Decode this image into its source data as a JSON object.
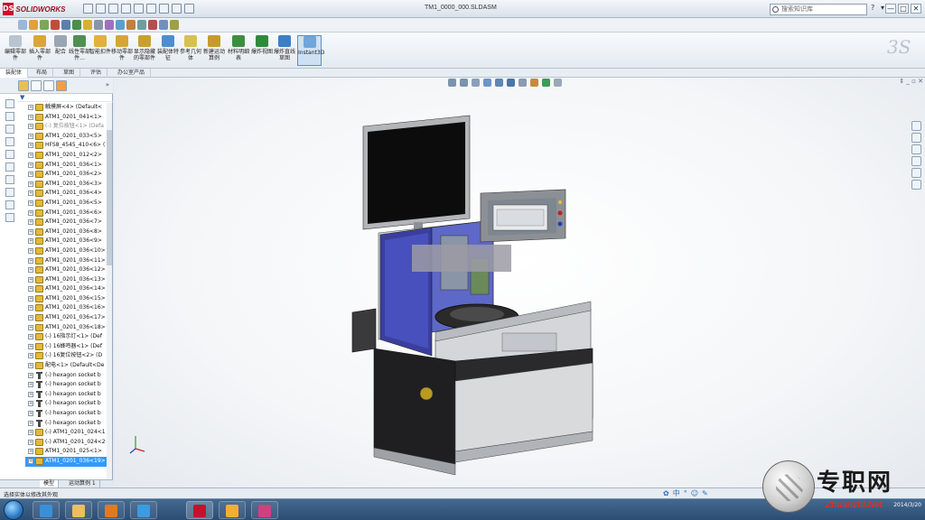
{
  "app": {
    "logo_text": "SOLIDWORKS",
    "document_title": "TM1_0000_000.SLDASM",
    "search_placeholder": "搜索知识库",
    "window_controls": [
      "—",
      "□",
      "✕"
    ]
  },
  "command_manager": {
    "buttons": [
      {
        "label": "编辑零部件",
        "icon": "edit-component-icon"
      },
      {
        "label": "插入零部件",
        "icon": "insert-component-icon"
      },
      {
        "label": "配合",
        "icon": "mate-icon"
      },
      {
        "label": "线性零部件...",
        "icon": "linear-pattern-icon"
      },
      {
        "label": "智能扣件",
        "icon": "smart-fastener-icon"
      },
      {
        "label": "移动零部件",
        "icon": "move-component-icon"
      },
      {
        "label": "显示隐藏的零部件",
        "icon": "show-hidden-icon"
      },
      {
        "label": "装配体特征",
        "icon": "assembly-feature-icon"
      },
      {
        "label": "参考几何体",
        "icon": "reference-geometry-icon"
      },
      {
        "label": "新建运动算例",
        "icon": "motion-study-icon"
      },
      {
        "label": "材料明细表",
        "icon": "bom-icon"
      },
      {
        "label": "爆炸视图",
        "icon": "exploded-view-icon"
      },
      {
        "label": "爆炸直线草图",
        "icon": "explode-line-icon"
      },
      {
        "label": "Instant3D",
        "icon": "instant3d-icon"
      }
    ]
  },
  "tabs": [
    "装配体",
    "布局",
    "草图",
    "评估",
    "办公室产品"
  ],
  "tree": {
    "items": [
      {
        "label": "触摸屏<4> (Default<",
        "type": "part",
        "grey": false,
        "selected": false
      },
      {
        "label": "ATM1_0201_041<1>",
        "type": "part",
        "grey": false,
        "selected": false
      },
      {
        "label": "(-) 复位按钮<1> (Defa",
        "type": "part",
        "grey": true,
        "selected": false
      },
      {
        "label": "ATM1_0201_033<5>",
        "type": "part",
        "grey": false,
        "selected": false
      },
      {
        "label": "HFS8_4545_410<6> (",
        "type": "part",
        "grey": false,
        "selected": false
      },
      {
        "label": "ATM1_0201_012<2>",
        "type": "part",
        "grey": false,
        "selected": false
      },
      {
        "label": "ATM1_0201_036<1>",
        "type": "part",
        "grey": false,
        "selected": false
      },
      {
        "label": "ATM1_0201_036<2>",
        "type": "part",
        "grey": false,
        "selected": false
      },
      {
        "label": "ATM1_0201_036<3>",
        "type": "part",
        "grey": false,
        "selected": false
      },
      {
        "label": "ATM1_0201_036<4>",
        "type": "part",
        "grey": false,
        "selected": false
      },
      {
        "label": "ATM1_0201_036<5>",
        "type": "part",
        "grey": false,
        "selected": false
      },
      {
        "label": "ATM1_0201_036<6>",
        "type": "part",
        "grey": false,
        "selected": false
      },
      {
        "label": "ATM1_0201_036<7>",
        "type": "part",
        "grey": false,
        "selected": false
      },
      {
        "label": "ATM1_0201_036<8>",
        "type": "part",
        "grey": false,
        "selected": false
      },
      {
        "label": "ATM1_0201_036<9>",
        "type": "part",
        "grey": false,
        "selected": false
      },
      {
        "label": "ATM1_0201_036<10>",
        "type": "part",
        "grey": false,
        "selected": false
      },
      {
        "label": "ATM1_0201_036<11>",
        "type": "part",
        "grey": false,
        "selected": false
      },
      {
        "label": "ATM1_0201_036<12>",
        "type": "part",
        "grey": false,
        "selected": false
      },
      {
        "label": "ATM1_0201_036<13>",
        "type": "part",
        "grey": false,
        "selected": false
      },
      {
        "label": "ATM1_0201_036<14>",
        "type": "part",
        "grey": false,
        "selected": false
      },
      {
        "label": "ATM1_0201_036<15>",
        "type": "part",
        "grey": false,
        "selected": false
      },
      {
        "label": "ATM1_0201_036<16>",
        "type": "part",
        "grey": false,
        "selected": false
      },
      {
        "label": "ATM1_0201_036<17>",
        "type": "part",
        "grey": false,
        "selected": false
      },
      {
        "label": "ATM1_0201_036<18>",
        "type": "part",
        "grey": false,
        "selected": false
      },
      {
        "label": "(-) 16指示灯<1> (Def",
        "type": "part",
        "grey": false,
        "selected": false
      },
      {
        "label": "(-) 16蜂鸣器<1> (Def",
        "type": "part",
        "grey": false,
        "selected": false
      },
      {
        "label": "(-) 16复位按钮<2> (D",
        "type": "part",
        "grey": false,
        "selected": false
      },
      {
        "label": "配电<1> (Default<De",
        "type": "part",
        "grey": false,
        "selected": false
      },
      {
        "label": "(-) hexagon socket b",
        "type": "screw",
        "grey": false,
        "selected": false
      },
      {
        "label": "(-) hexagon socket b",
        "type": "screw",
        "grey": false,
        "selected": false
      },
      {
        "label": "(-) hexagon socket b",
        "type": "screw",
        "grey": false,
        "selected": false
      },
      {
        "label": "(-) hexagon socket b",
        "type": "screw",
        "grey": false,
        "selected": false
      },
      {
        "label": "(-) hexagon socket b",
        "type": "screw",
        "grey": false,
        "selected": false
      },
      {
        "label": "(-) hexagon socket b",
        "type": "screw",
        "grey": false,
        "selected": false
      },
      {
        "label": "(-) ATM1_0201_024<1",
        "type": "part",
        "grey": false,
        "selected": false
      },
      {
        "label": "(-) ATM1_0201_024<2",
        "type": "part",
        "grey": false,
        "selected": false
      },
      {
        "label": "ATM1_0201_025<1>",
        "type": "part",
        "grey": false,
        "selected": false
      },
      {
        "label": "ATM1_0201_036<19>",
        "type": "part",
        "grey": false,
        "selected": true
      }
    ]
  },
  "bottom_tabs": [
    "模型",
    "运动算例 1"
  ],
  "status": {
    "message": "选择实体以修改其外观"
  },
  "ime": {
    "lang": "中"
  },
  "tray": {
    "date": "2014/3/20"
  },
  "watermark": {
    "text": "专职网",
    "url": "Zhuanzhi.Net"
  }
}
